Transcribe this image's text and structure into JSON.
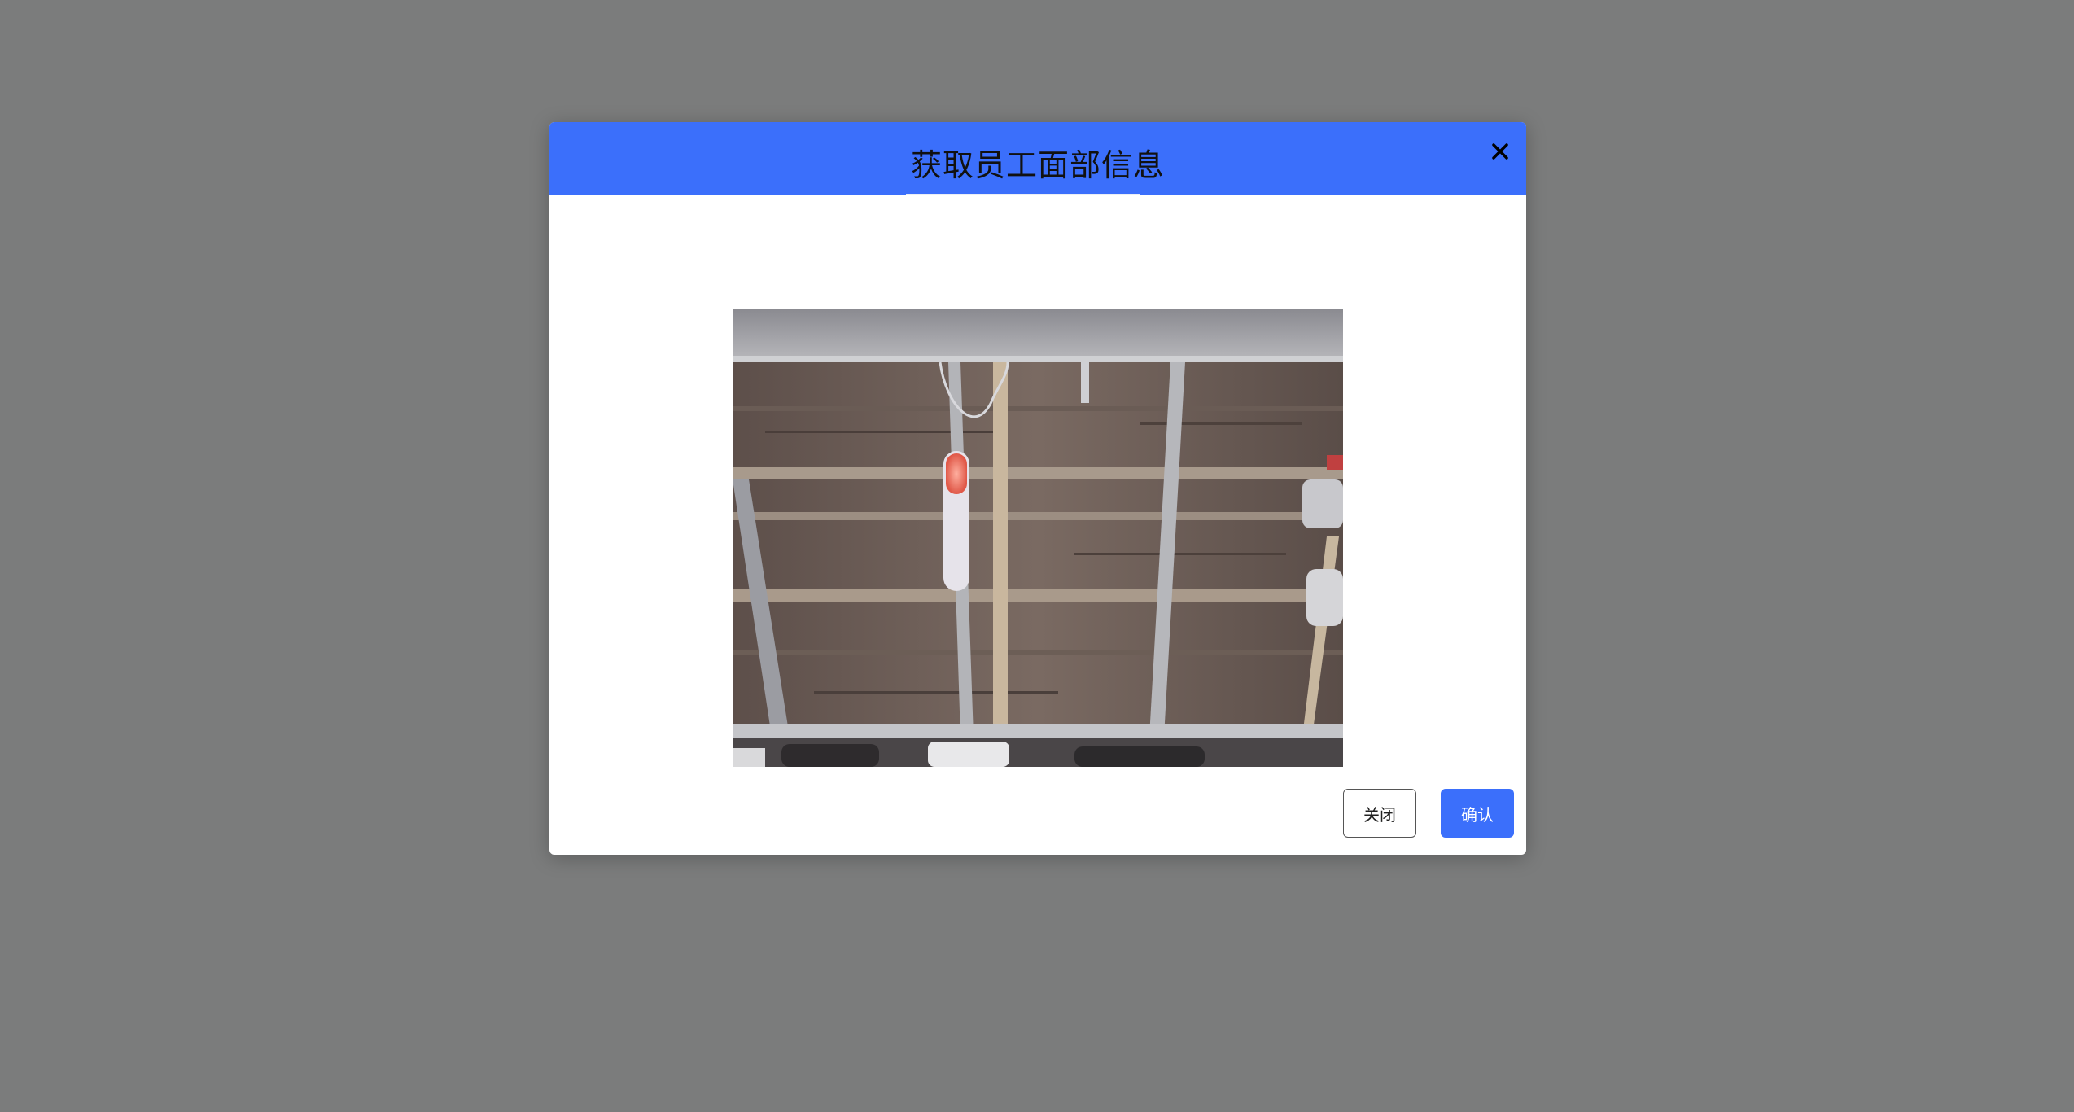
{
  "dialog": {
    "title": "获取员工面部信息",
    "close_icon": "close-icon",
    "camera_preview": "webcam-feed-image",
    "buttons": {
      "close_label": "关闭",
      "confirm_label": "确认"
    }
  },
  "colors": {
    "overlay": "#7b7c7c",
    "header": "#3b6ffb",
    "confirm_button": "#3b6ffb",
    "dialog_body": "#ffffff"
  }
}
